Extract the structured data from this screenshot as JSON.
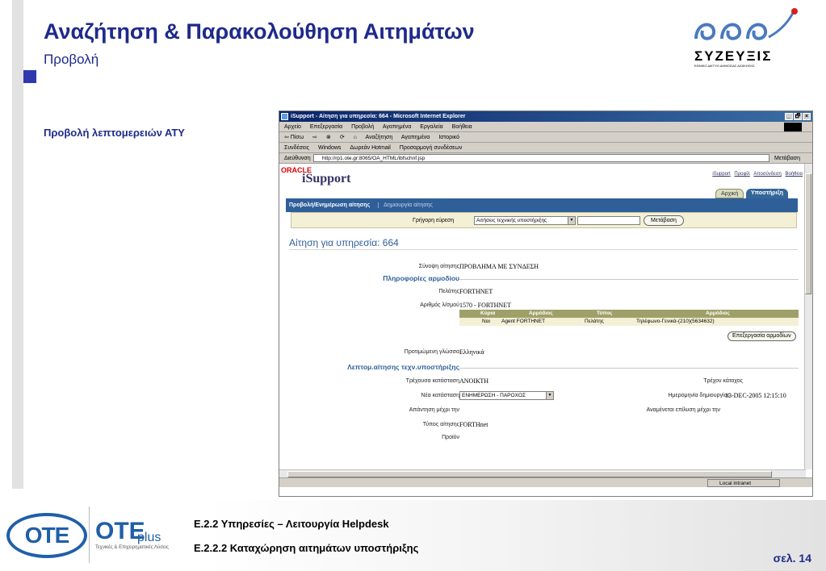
{
  "slide": {
    "title": "Αναζήτηση & Παρακολούθηση Αιτημάτων",
    "subtitle": "Προβολή",
    "section_label": "Προβολή λεπτομερειών ΑΤΥ",
    "logo_text": "ΣΥΖΕΥΞΙΣ",
    "logo_subtext": "ΕΘΝΙΚΟ ΔΙΚΤΥΟ ΔΗΜΟΣΙΑΣ ΔΙΟΙΚΗΣΗΣ",
    "accent_color": "#1e2a8a"
  },
  "browser": {
    "window_title": "iSupport - Αίτηση για υπηρεσία: 664 - Microsoft Internet Explorer",
    "window_buttons": [
      "_",
      "🗗",
      "×"
    ],
    "menu": [
      "Αρχείο",
      "Επεξεργασία",
      "Προβολή",
      "Αγαπημένα",
      "Εργαλεία",
      "Βοήθεια"
    ],
    "toolbar": [
      "⇦ Πίσω",
      "⇨",
      "⊗",
      "⟳",
      "⌂",
      "Αναζήτηση",
      "Αγαπημένα",
      "Ιστορικό"
    ],
    "links_bar": [
      "Συνδέσεις",
      "Windows",
      "Δωρεάν Hotmail",
      "Προσαρμογή συνδέσεων"
    ],
    "address_label": "Διεύθυνση",
    "address": "http://rp1.ote.gr:8065/OA_HTML/ibfschnf.jsp",
    "go_label": "Μετάβαση",
    "status_zone": "Local intranet"
  },
  "app": {
    "brand": "ORACLE",
    "product": "iSupport",
    "top_links": [
      "iSupport",
      "Προφίλ",
      "Αποσύνδεση",
      "Βοήθεια"
    ],
    "tabs": [
      "Αρχική",
      "Υποστήριξη"
    ],
    "subtabs": [
      "Προβολή/Ενημέρωση αίτησης",
      "Δημιουργία αίτησης"
    ],
    "quick_find_label": "Γρήγορη εύρεση",
    "quick_find_select": "Αιτήσεις τεχνικής υποστήριξης",
    "quick_find_button": "Μετάβαση",
    "request_title": "Αίτηση για υπηρεσία: 664",
    "summary_label": "Σύνοψη αίτησης",
    "summary_value": "ΠΡΟΒΛΗΜΑ ΜΕ ΣΥΝΔΕΣΗ",
    "contact_header": "Πληροφορίες αρμοδίου",
    "customer_label": "Πελάτης",
    "customer_value": "FORTHNET",
    "account_label": "Αριθμός λ/σμού",
    "account_value": "1570 - FORTHNET",
    "contacts_table": {
      "headers": [
        "Κύρια",
        "Αρμόδιος",
        "Τύπος",
        "Αρμόδιος"
      ],
      "rows": [
        [
          "Ναι",
          "Agent FORTHNET",
          "Πελάτης",
          "Τηλέφωνο-Γενικά-(210)(5634632)"
        ]
      ]
    },
    "edit_contacts_button": "Επεξεργασία αρμοδίων",
    "language_label": "Προτιμώμενη γλώσσα",
    "language_value": "Ελληνικά",
    "details_header": "Λεπτομ.αίτησης τεχν.υποστήριξης",
    "status_label": "Τρέχουσα κατάσταση",
    "status_value": "ΑΝΟΙΚΤΗ",
    "owner_label": "Τρέχον κάτοχος",
    "new_status_label": "Νέα κατάσταση",
    "new_status_value": "ΕΝΗΜΕΡΩΣΗ - ΠΑΡΟΧΟΣ",
    "created_label": "Ημερομηνία δημιουργίας",
    "created_value": "13-DEC-2005  12:15:10",
    "reply_label": "Απάντηση μέχρι την",
    "expected_label": "Αναμένεται επίλυση μέχρι την",
    "type_label": "Τύπος αίτησης",
    "type_value": "FORTHnet",
    "product_label": "Προϊόν"
  },
  "footer": {
    "ote_logo": "OTE",
    "oteplus": "OTE",
    "oteplus_suffix": "plus",
    "ote_tag": "Τεχνικές & Επιχειρηματικές Λύσεις",
    "line1": "Ε.2.2 Υπηρεσίες – Λειτουργία Helpdesk",
    "line2": "Ε.2.2.2 Καταχώρηση αιτημάτων υποστήριξης",
    "page": "σελ. 14"
  }
}
